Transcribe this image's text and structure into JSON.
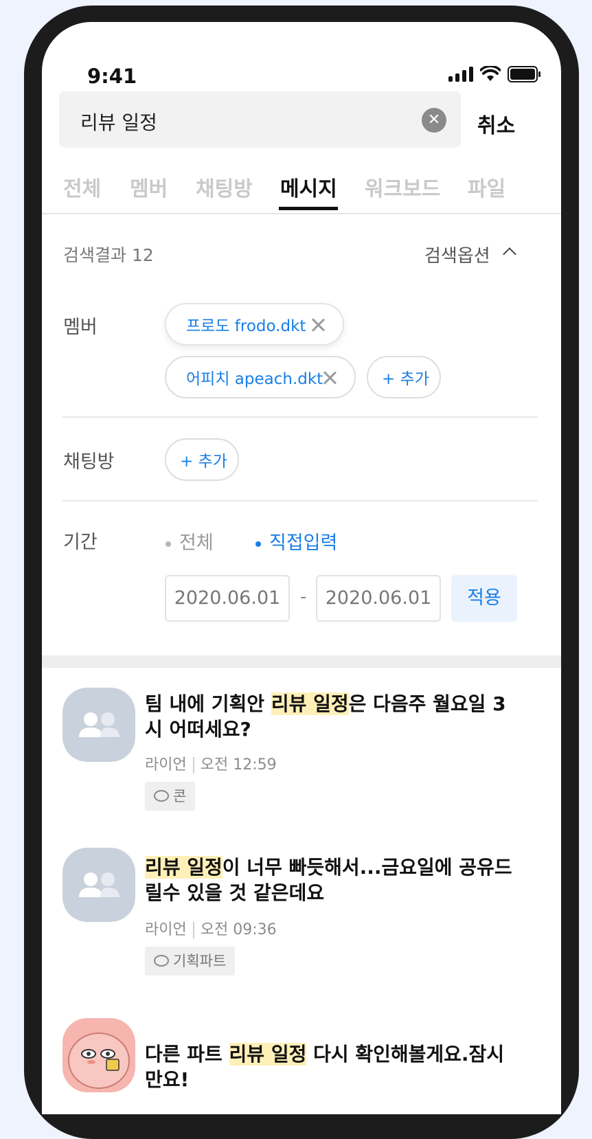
{
  "status_bar": {
    "time": "9:41",
    "icons": [
      "signal-icon",
      "wifi-icon",
      "battery-icon"
    ]
  },
  "search": {
    "query": "리뷰 일정",
    "cancel_label": "취소"
  },
  "tabs": [
    {
      "label": "전체",
      "active": false
    },
    {
      "label": "멤버",
      "active": false
    },
    {
      "label": "채팅방",
      "active": false
    },
    {
      "label": "메시지",
      "active": true
    },
    {
      "label": "워크보드",
      "active": false
    },
    {
      "label": "파일",
      "active": false
    }
  ],
  "results_header": {
    "count_label": "검색결과 12",
    "options_label": "검색옵션"
  },
  "filters": {
    "member": {
      "label": "멤버",
      "chips": [
        "프로도 frodo.dkt",
        "어피치 apeach.dkt"
      ],
      "add_label": "+ 추가"
    },
    "chatroom": {
      "label": "채팅방",
      "add_label": "+ 추가"
    },
    "period": {
      "label": "기간",
      "options": [
        {
          "label": "전체",
          "selected": false
        },
        {
          "label": "직접입력",
          "selected": true
        }
      ],
      "start_date": "2020.06.01",
      "separator": "-",
      "end_date": "2020.06.01",
      "apply_label": "적용"
    }
  },
  "results": [
    {
      "text_before": "팀 내에 기획안 ",
      "highlight": "리뷰 일정",
      "text_after": "은 다음주 월요일 3시 어떠세요?",
      "sender": "라이언",
      "time": "오전 12:59",
      "room": "콘"
    },
    {
      "text_before": "",
      "highlight": "리뷰 일정",
      "text_after": "이 너무 빠듯해서...금요일에 공유드릴수 있을 것 같은데요",
      "sender": "라이언",
      "time": "오전 09:36",
      "room": "기획파트"
    },
    {
      "text_before": "다른 파트 ",
      "highlight": "리뷰 일정",
      "text_after": " 다시 확인해볼게요.잠시만요!"
    }
  ],
  "colors": {
    "accent": "#1a7ee6",
    "highlight": "#fff0b8",
    "avatar": "#c9d1dc"
  }
}
